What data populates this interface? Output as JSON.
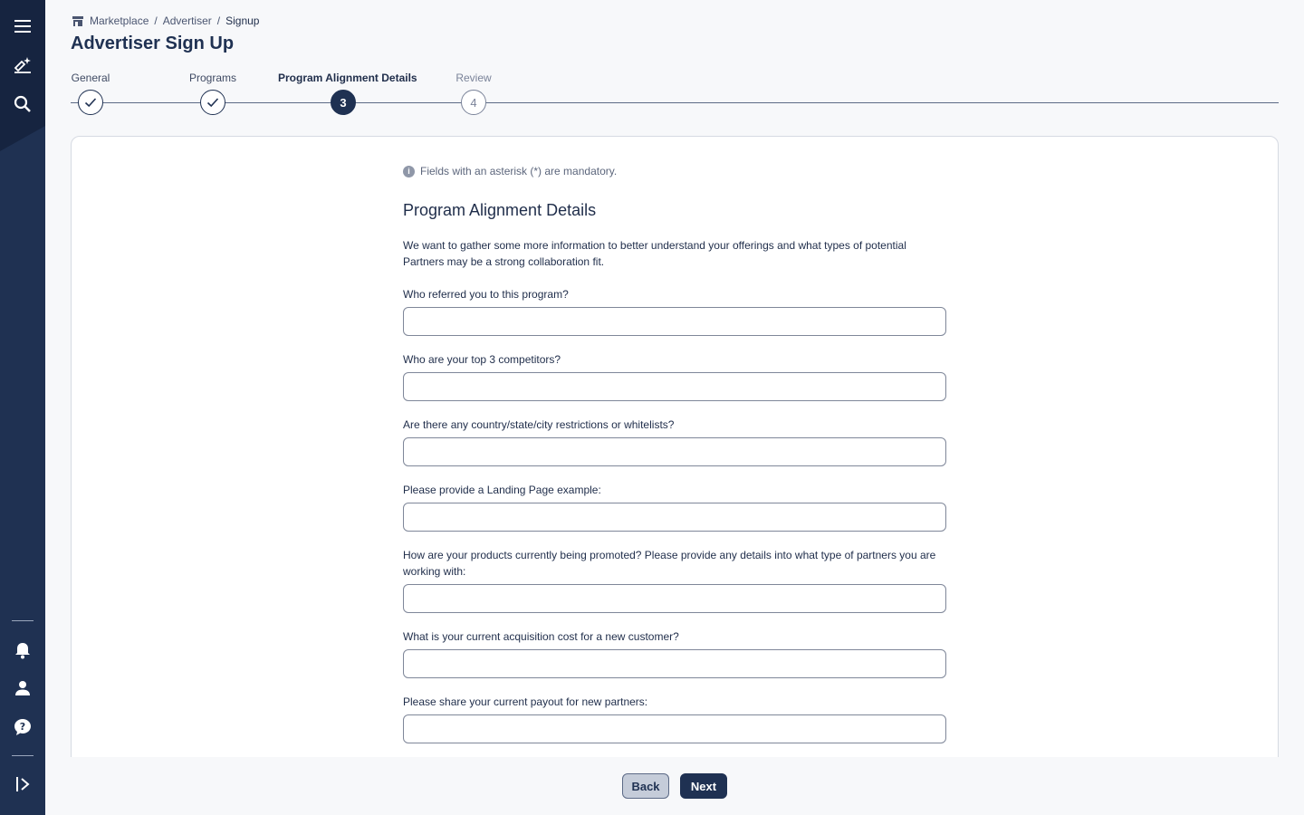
{
  "sidebar": {
    "top_icons": [
      "menu-icon",
      "sparkle-icon",
      "search-icon"
    ],
    "bottom_icons": [
      "bell-icon",
      "user-icon",
      "help-icon",
      "expand-icon"
    ]
  },
  "breadcrumb": {
    "items": [
      "Marketplace",
      "Advertiser",
      "Signup"
    ]
  },
  "page": {
    "title": "Advertiser Sign Up"
  },
  "stepper": {
    "steps": [
      {
        "label": "General",
        "state": "complete",
        "marker": "✓"
      },
      {
        "label": "Programs",
        "state": "complete",
        "marker": "✓"
      },
      {
        "label": "Program Alignment Details",
        "state": "active",
        "marker": "3"
      },
      {
        "label": "Review",
        "state": "future",
        "marker": "4"
      }
    ]
  },
  "form": {
    "mandatory_note": "Fields with an asterisk (*) are mandatory.",
    "section_title": "Program Alignment Details",
    "section_desc": "We want to gather some more information to better understand your offerings and what types of potential Partners may be a strong collaboration fit.",
    "fields": [
      {
        "label": "Who referred you to this program?",
        "value": ""
      },
      {
        "label": "Who are your top 3 competitors?",
        "value": ""
      },
      {
        "label": "Are there any country/state/city restrictions or whitelists?",
        "value": ""
      },
      {
        "label": "Please provide a Landing Page example:",
        "value": ""
      },
      {
        "label": "How are your products currently being promoted? Please provide any details into what type of partners you are working with:",
        "value": ""
      },
      {
        "label": "What is your current acquisition cost for a new customer?",
        "value": ""
      },
      {
        "label": "Please share your current payout for new partners:",
        "value": ""
      }
    ]
  },
  "footer": {
    "back_label": "Back",
    "next_label": "Next"
  },
  "colors": {
    "navy": "#1f3152",
    "background": "#f7f8fa",
    "border": "#d6dae2"
  }
}
